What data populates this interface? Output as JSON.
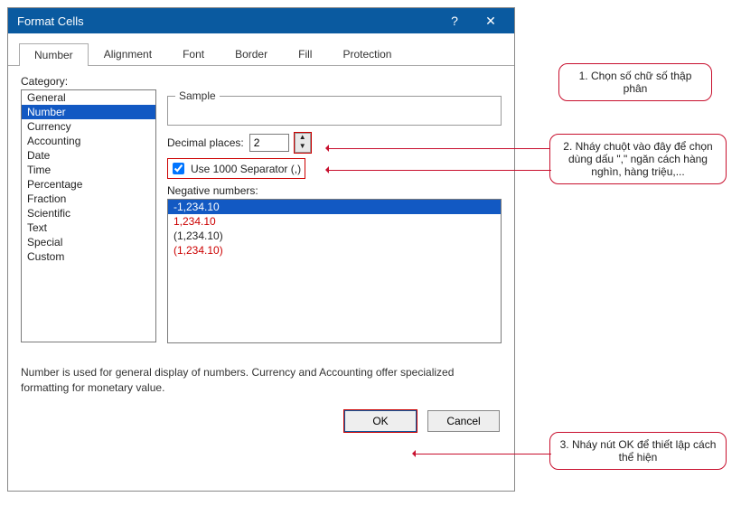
{
  "dialog": {
    "title": "Format Cells",
    "help": "?",
    "close": "✕"
  },
  "tabs": [
    "Number",
    "Alignment",
    "Font",
    "Border",
    "Fill",
    "Protection"
  ],
  "active_tab": 0,
  "category_label": "Category:",
  "categories": [
    "General",
    "Number",
    "Currency",
    "Accounting",
    "Date",
    "Time",
    "Percentage",
    "Fraction",
    "Scientific",
    "Text",
    "Special",
    "Custom"
  ],
  "selected_category": 1,
  "sample_label": "Sample",
  "decimal_label": "Decimal places:",
  "decimal_value": "2",
  "separator_label": "Use 1000 Separator (,)",
  "separator_checked": true,
  "negative_label": "Negative numbers:",
  "negative_numbers": [
    {
      "text": "-1,234.10",
      "sel": true
    },
    {
      "text": "1,234.10",
      "red": true
    },
    {
      "text": "(1,234.10)"
    },
    {
      "text": "(1,234.10)",
      "red": true
    }
  ],
  "description": "Number is used for general display of numbers.  Currency and Accounting offer specialized formatting for monetary value.",
  "ok_label": "OK",
  "cancel_label": "Cancel",
  "callouts": {
    "c1": "1. Chọn số chữ số thập phân",
    "c2": "2. Nháy chuột vào đây để chọn dùng dấu \",\" ngăn cách hàng nghìn, hàng triệu,...",
    "c3": "3. Nháy nút OK để thiết lập cách thể hiện"
  }
}
